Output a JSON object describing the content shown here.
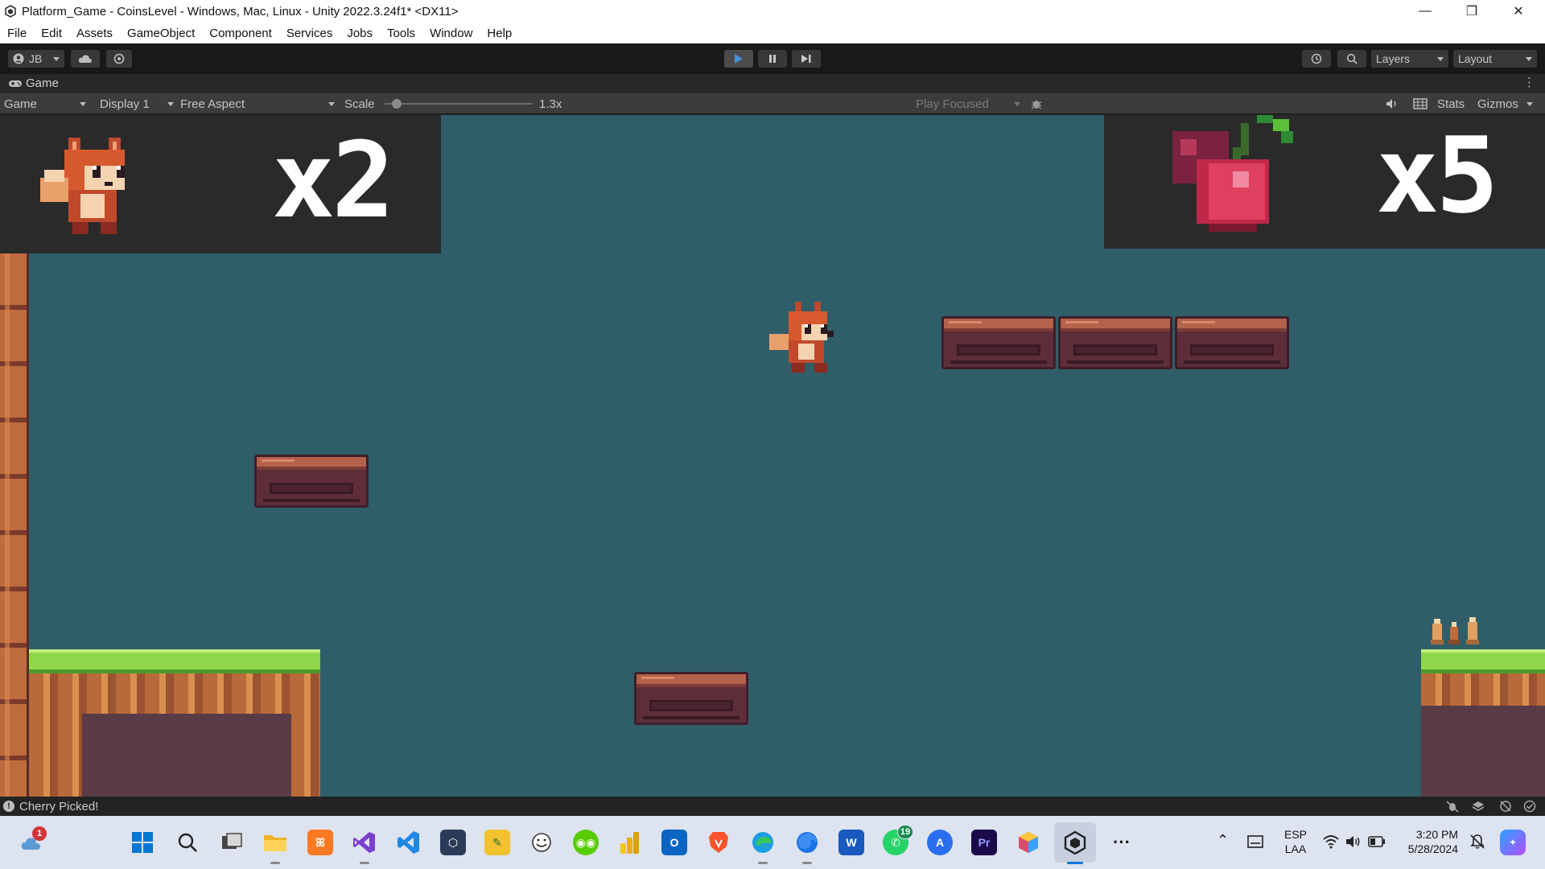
{
  "window": {
    "title": "Platform_Game - CoinsLevel - Windows, Mac, Linux - Unity 2022.3.24f1* <DX11>",
    "controls": {
      "minimize": "—",
      "restore": "❐",
      "close": "✕"
    }
  },
  "menu": [
    "File",
    "Edit",
    "Assets",
    "GameObject",
    "Component",
    "Services",
    "Jobs",
    "Tools",
    "Window",
    "Help"
  ],
  "toolbar": {
    "account": "JB",
    "layers": "Layers",
    "layout": "Layout"
  },
  "game_tab": {
    "label": "Game"
  },
  "game_bar": {
    "view": "Game",
    "display": "Display 1",
    "aspect": "Free Aspect",
    "scale_label": "Scale",
    "scale_value": "1.3x",
    "scale_level": 0.05,
    "play_mode": "Play Focused",
    "stats": "Stats",
    "gizmos": "Gizmos"
  },
  "hud": {
    "lives": "x2",
    "cherries": "x5"
  },
  "status": {
    "message": "Cherry Picked!"
  },
  "taskbar": {
    "apps": [
      "windows-start",
      "search",
      "task-view",
      "file-explorer",
      "xampp",
      "visual-studio",
      "vs-code",
      "unity-hub",
      "paint-tool",
      "emoji",
      "duolingo",
      "power-bi",
      "outlook-new",
      "brave",
      "edge-dev",
      "firefox",
      "word",
      "whatsapp",
      "app-store",
      "premiere-pro",
      "app-cube",
      "unity",
      "more"
    ],
    "whatsapp_badge": "19",
    "weather_badge": "1",
    "premiere_label": "Pr",
    "word_label": "W",
    "language": "ESP",
    "keyboard": "LAA",
    "time": "3:20 PM",
    "date": "5/28/2024"
  },
  "colors": {
    "game_bg": "#2f5e69",
    "grass": "#8fd64a",
    "dirt": "#b86a3b",
    "platform": "#b3624b",
    "accent_play": "#4a90d9"
  }
}
